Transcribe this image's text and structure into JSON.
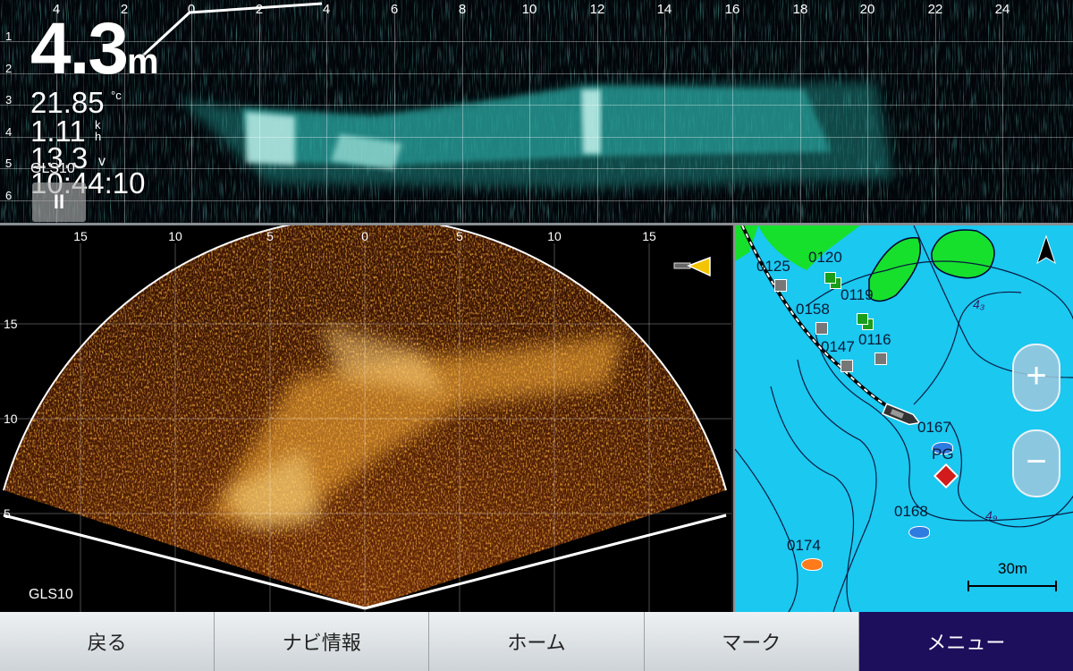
{
  "top_panel": {
    "x_ticks": [
      "4",
      "2",
      "0",
      "2",
      "4",
      "6",
      "8",
      "10",
      "12",
      "14",
      "16",
      "18",
      "20",
      "22",
      "24"
    ],
    "depth_ticks": [
      "1",
      "2",
      "3",
      "4",
      "5",
      "6"
    ],
    "depth_value": "4.3",
    "depth_unit": "m",
    "water_temp": "21.85",
    "temp_unit": "°c",
    "speed_value": "1.11",
    "speed_unit": "kh",
    "voltage_value": "13.3",
    "voltage_unit": "v",
    "clock": "10:44:10",
    "source_label": "GLS10",
    "pause_label": "II",
    "echo_color": "#33d6cc"
  },
  "scope_panel": {
    "x_ticks": [
      "15",
      "10",
      "5",
      "0",
      "5",
      "10",
      "15"
    ],
    "y_ticks": [
      "15",
      "10",
      "5"
    ],
    "source_label": "GLS10",
    "transducer_icon": "transducer-icon",
    "echo_color": "#ff8a1f"
  },
  "chart_panel": {
    "north_icon": "north-arrow-icon",
    "waypoints": [
      {
        "label": "0125"
      },
      {
        "label": "0120"
      },
      {
        "label": "0119"
      },
      {
        "label": "0158"
      },
      {
        "label": "0147"
      },
      {
        "label": "0116"
      },
      {
        "label": "0167"
      },
      {
        "label": "PG"
      },
      {
        "label": "0168"
      },
      {
        "label": "0174"
      }
    ],
    "contour_labels": [
      "4₃",
      "4₉"
    ],
    "zoom_in_label": "+",
    "zoom_out_label": "−",
    "scale_label": "30m",
    "water_color": "#1ac8f0",
    "land_color": "#16e02c"
  },
  "nav": {
    "back": "戻る",
    "nav_info": "ナビ情報",
    "home": "ホーム",
    "mark": "マーク",
    "menu": "メニュー"
  }
}
